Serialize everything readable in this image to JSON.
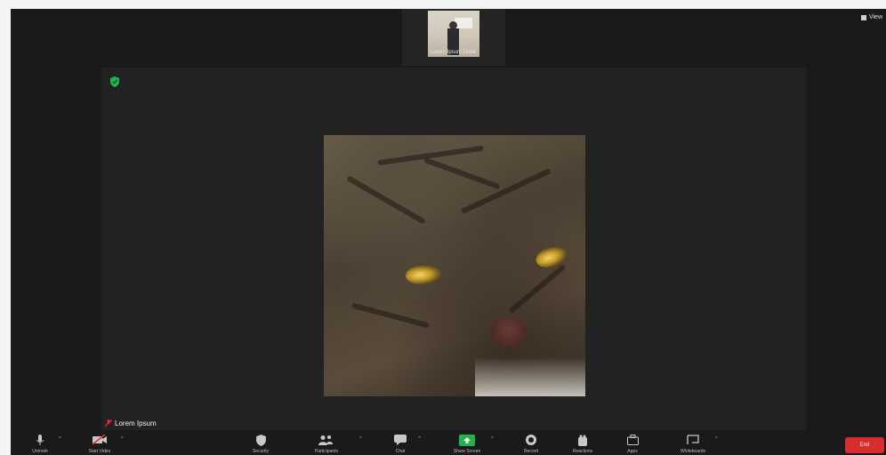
{
  "top_strip": {
    "thumbnail_name": "Lorem Ipsum Dolor",
    "view_toggle": "View"
  },
  "main": {
    "participant_name": "Lorem Ipsum"
  },
  "toolbar": {
    "items": [
      {
        "label": "Unmute",
        "icon": "mic-icon"
      },
      {
        "label": "Start Video",
        "icon": "video-off-icon"
      },
      {
        "label": "Security",
        "icon": "shield-icon"
      },
      {
        "label": "Participants",
        "icon": "participants-icon"
      },
      {
        "label": "Chat",
        "icon": "chat-icon"
      },
      {
        "label": "Share Screen",
        "icon": "share-screen-icon"
      },
      {
        "label": "Record",
        "icon": "record-icon"
      },
      {
        "label": "Reactions",
        "icon": "reactions-icon"
      },
      {
        "label": "Apps",
        "icon": "apps-icon"
      },
      {
        "label": "Whiteboards",
        "icon": "whiteboard-icon"
      }
    ],
    "end_label": "End"
  },
  "colors": {
    "background": "#1a1a1a",
    "tile": "#222222",
    "share_green": "#20b24b",
    "end_red": "#d92d2d",
    "muted_red": "#e0312f"
  }
}
